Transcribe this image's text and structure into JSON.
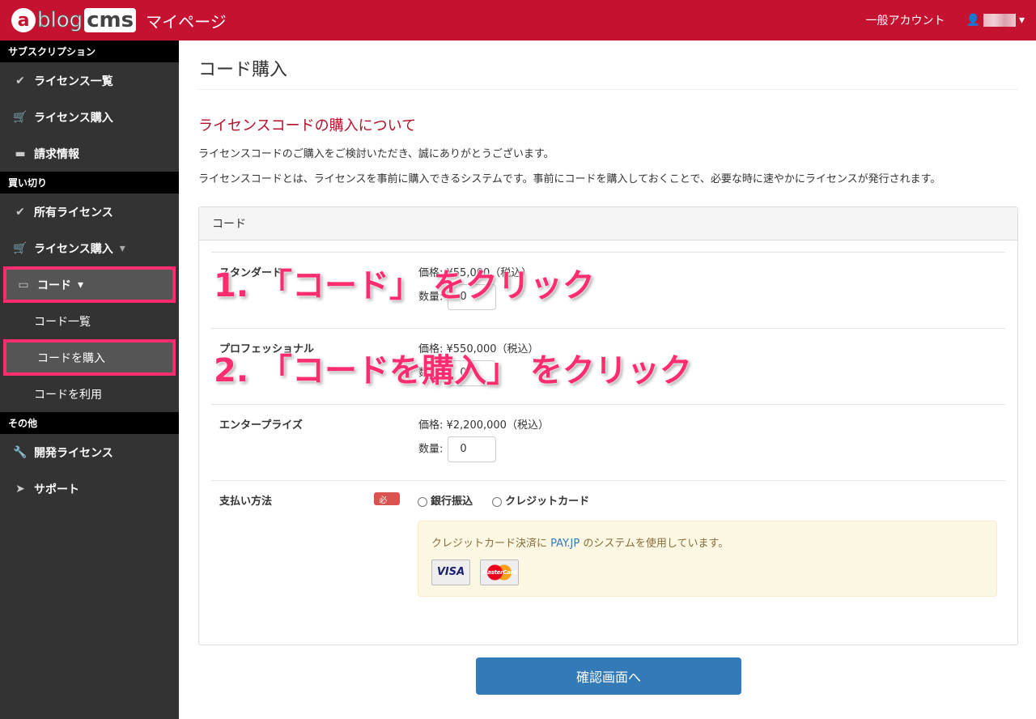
{
  "header": {
    "logo": "a-blog cms",
    "app_title": "マイページ",
    "account_type": "一般アカウント"
  },
  "sidebar": {
    "sections": [
      {
        "title": "サブスクリプション",
        "items": [
          {
            "label": "ライセンス一覧",
            "icon": "check-circle-icon"
          },
          {
            "label": "ライセンス購入",
            "icon": "cart-icon"
          },
          {
            "label": "請求情報",
            "icon": "credit-card-icon"
          }
        ]
      },
      {
        "title": "買い切り",
        "items": [
          {
            "label": "所有ライセンス",
            "icon": "check-circle-icon"
          },
          {
            "label": "ライセンス購入",
            "icon": "cart-icon"
          },
          {
            "label": "コード",
            "icon": "ticket-icon"
          }
        ],
        "subitems": [
          {
            "label": "コード一覧"
          },
          {
            "label": "コードを購入"
          },
          {
            "label": "コードを利用"
          }
        ]
      },
      {
        "title": "その他",
        "items": [
          {
            "label": "開発ライセンス",
            "icon": "wrench-icon"
          },
          {
            "label": "サポート",
            "icon": "paper-plane-icon"
          }
        ]
      }
    ]
  },
  "main": {
    "title": "コード購入",
    "subtitle": "ライセンスコードの購入について",
    "para1": "ライセンスコードのご購入をご検討いただき、誠にありがとうございます。",
    "para2": "ライセンスコードとは、ライセンスを事前に購入できるシステムです。事前にコードを購入しておくことで、必要な時に速やかにライセンスが発行されます。",
    "panel_title": "コード",
    "products": [
      {
        "name": "スタンダード",
        "price": "価格: ¥55,000（税込）",
        "qty_label": "数量:",
        "qty": "0"
      },
      {
        "name": "プロフェッショナル",
        "price": "価格: ¥550,000（税込）",
        "qty_label": "数量:",
        "qty": "0"
      },
      {
        "name": "エンタープライズ",
        "price": "価格: ¥2,200,000（税込）",
        "qty_label": "数量:",
        "qty": "0"
      }
    ],
    "payment": {
      "label": "支払い方法",
      "required": "必須",
      "options": [
        "銀行振込",
        "クレジットカード"
      ],
      "note_pre": "クレジットカード決済に",
      "note_link": "PAY.JP",
      "note_post": "のシステムを使用しています。",
      "cards": [
        "VISA",
        "MasterCard"
      ]
    },
    "confirm_button": "確認画面へ"
  },
  "annotations": [
    "1. 「コード」 をクリック",
    "2. 「コードを購入」 をクリック"
  ],
  "colors": {
    "brand": "#c41230",
    "highlight": "#ff2d6f",
    "primary": "#337ab7"
  }
}
